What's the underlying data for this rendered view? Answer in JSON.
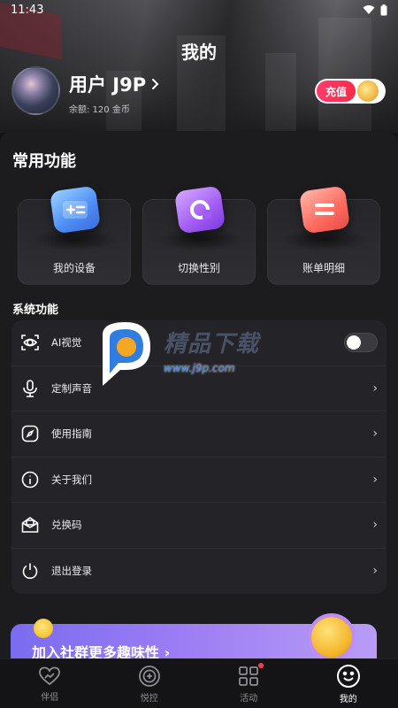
{
  "status_bar": {
    "time": "11:43"
  },
  "header": {
    "title": "我的",
    "username": "用户 J9P",
    "balance": "余额: 120 金币",
    "recharge_label": "充值"
  },
  "common": {
    "title": "常用功能",
    "items": [
      {
        "label": "我的设备",
        "icon": "device-card-icon"
      },
      {
        "label": "切换性别",
        "icon": "switch-gender-icon"
      },
      {
        "label": "账单明细",
        "icon": "bill-detail-icon"
      }
    ]
  },
  "system": {
    "title": "系统功能",
    "items": [
      {
        "label": "AI视觉",
        "icon": "ai-vision-icon",
        "control": "toggle",
        "toggle_on": false
      },
      {
        "label": "定制声音",
        "icon": "microphone-icon"
      },
      {
        "label": "使用指南",
        "icon": "compass-icon"
      },
      {
        "label": "关于我们",
        "icon": "info-icon"
      },
      {
        "label": "兑换码",
        "icon": "coupon-envelope-icon"
      },
      {
        "label": "退出登录",
        "icon": "power-icon"
      }
    ]
  },
  "watermark": {
    "brand": "精品下载",
    "url": "www.j9p.com"
  },
  "banner": {
    "text": "加入社群更多趣味性 ›"
  },
  "tabbar": {
    "items": [
      {
        "label": "伴侣",
        "icon": "heart-icon",
        "active": false
      },
      {
        "label": "悦控",
        "icon": "plus-circle-icon",
        "active": false
      },
      {
        "label": "活动",
        "icon": "grid-icon",
        "active": false,
        "badge": true
      },
      {
        "label": "我的",
        "icon": "smile-face-icon",
        "active": true
      }
    ]
  },
  "colors": {
    "background": "#141416",
    "card": "#242428",
    "recharge": "#ff2a4a",
    "banner": "#9b7cf4",
    "badge": "#ff3b4e"
  }
}
